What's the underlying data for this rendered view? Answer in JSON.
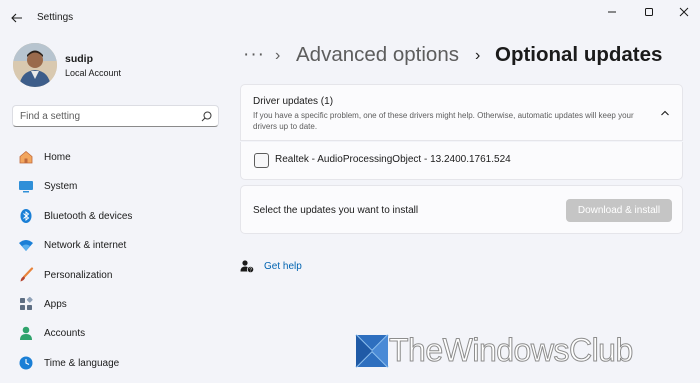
{
  "window": {
    "title": "Settings",
    "back_icon": "arrow-left-icon",
    "controls": [
      "minimize-icon",
      "maximize-icon",
      "close-icon"
    ]
  },
  "profile": {
    "name": "sudip",
    "account_type": "Local Account"
  },
  "search": {
    "placeholder": "Find a setting",
    "value": "",
    "icon": "search-icon"
  },
  "sidebar": {
    "items": [
      {
        "label": "Home",
        "icon": "home-icon"
      },
      {
        "label": "System",
        "icon": "system-monitor-icon"
      },
      {
        "label": "Bluetooth & devices",
        "icon": "bluetooth-icon"
      },
      {
        "label": "Network & internet",
        "icon": "wifi-icon"
      },
      {
        "label": "Personalization",
        "icon": "paintbrush-icon"
      },
      {
        "label": "Apps",
        "icon": "apps-grid-icon"
      },
      {
        "label": "Accounts",
        "icon": "person-icon"
      },
      {
        "label": "Time & language",
        "icon": "clock-globe-icon"
      }
    ]
  },
  "breadcrumb": {
    "ellipsis": "···",
    "separator": "›",
    "previous": "Advanced options",
    "current": "Optional updates"
  },
  "drivers": {
    "title": "Driver updates (1)",
    "description": "If you have a specific problem, one of these drivers might help. Otherwise, automatic updates will keep your drivers up to date.",
    "expanded": true,
    "items": [
      {
        "name": "Realtek - AudioProcessingObject - 13.2400.1761.524",
        "checked": false
      }
    ]
  },
  "install": {
    "prompt": "Select the updates you want to install",
    "button_label": "Download & install",
    "button_enabled": false
  },
  "help": {
    "label": "Get help",
    "icon": "help-person-icon"
  },
  "watermark": {
    "text": "TheWindowsClub"
  },
  "colors": {
    "background": "#f3f4f9",
    "card": "#fbfbfd",
    "link": "#0063b1",
    "disabled_button": "#c5c5c5"
  }
}
